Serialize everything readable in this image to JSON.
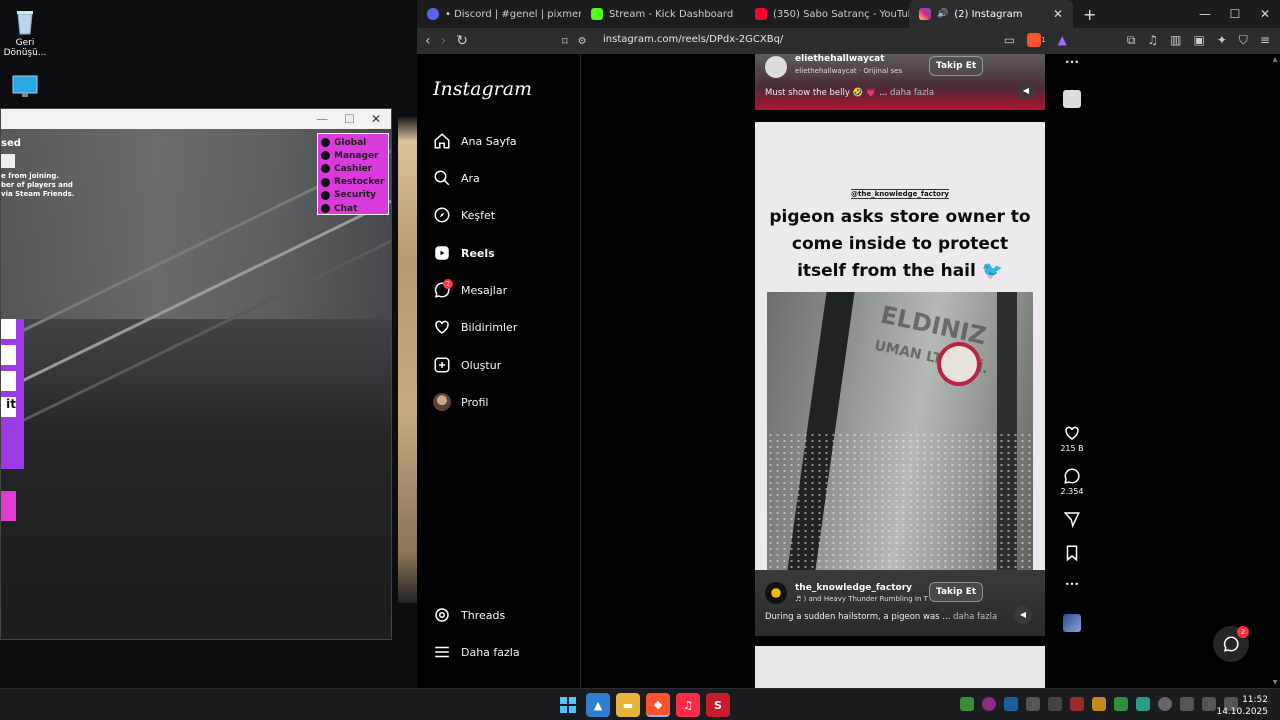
{
  "desktop": {
    "recycle_bin_label": "Geri Dönüşü..."
  },
  "game": {
    "heading_fragment": "sed",
    "notice_lines": [
      "e from joining.",
      "ber of players and",
      "via Steam Friends."
    ],
    "menu": [
      "Global",
      "Manager",
      "Cashier",
      "Restocker",
      "Security",
      "Chat"
    ],
    "panel_button_text": "it"
  },
  "browser": {
    "tabs": [
      {
        "label": "• Discord | #genel | pixmens",
        "color": "#5865f2"
      },
      {
        "label": "Stream - Kick Dashboard",
        "color": "#53fc18"
      },
      {
        "label": "(350) Sabo Satranç - YouTube",
        "color": "#ff0033"
      },
      {
        "label": "(2) Instagram",
        "color": "#d62976"
      }
    ],
    "url": "instagram.com/reels/DPdx-2GCXBq/",
    "shield_count": "1"
  },
  "instagram": {
    "logo": "Instagram",
    "nav": [
      {
        "label": "Ana Sayfa",
        "icon": "home-icon"
      },
      {
        "label": "Ara",
        "icon": "search-icon"
      },
      {
        "label": "Keşfet",
        "icon": "explore-icon"
      },
      {
        "label": "Reels",
        "icon": "reels-icon"
      },
      {
        "label": "Mesajlar",
        "icon": "messenger-icon",
        "badge": "2"
      },
      {
        "label": "Bildirimler",
        "icon": "heart-icon"
      },
      {
        "label": "Oluştur",
        "icon": "plus-square-icon"
      },
      {
        "label": "Profil",
        "icon": "avatar"
      }
    ],
    "threads_label": "Threads",
    "more_label": "Daha fazla",
    "prev_reel": {
      "author": "eliethehallwaycat",
      "audio": "eliethehallwaycat · Orijinal ses",
      "follow": "Takip Et",
      "caption": "Must show the belly 🤣 💗 ...",
      "more": "daha fazla"
    },
    "reel": {
      "overlay_handle": "@the_knowledge_factory",
      "headline": "pigeon asks store owner to come inside to protect itself from the hail 🐦",
      "glass_text": "ELDINIZ",
      "glass_text2": "UMAN LTD.ŞTİ.",
      "author": "the_knowledge_factory",
      "audio": "♬ ) and Heavy Thunder Rumbling In T",
      "follow": "Takip Et",
      "caption": "During a sudden hailstorm, a pigeon was ...",
      "more": "daha fazla",
      "likes": "215 B",
      "comments": "2.354"
    },
    "messages_badge": "2"
  },
  "taskbar": {
    "time": "11:52",
    "date": "14.10.2025"
  }
}
